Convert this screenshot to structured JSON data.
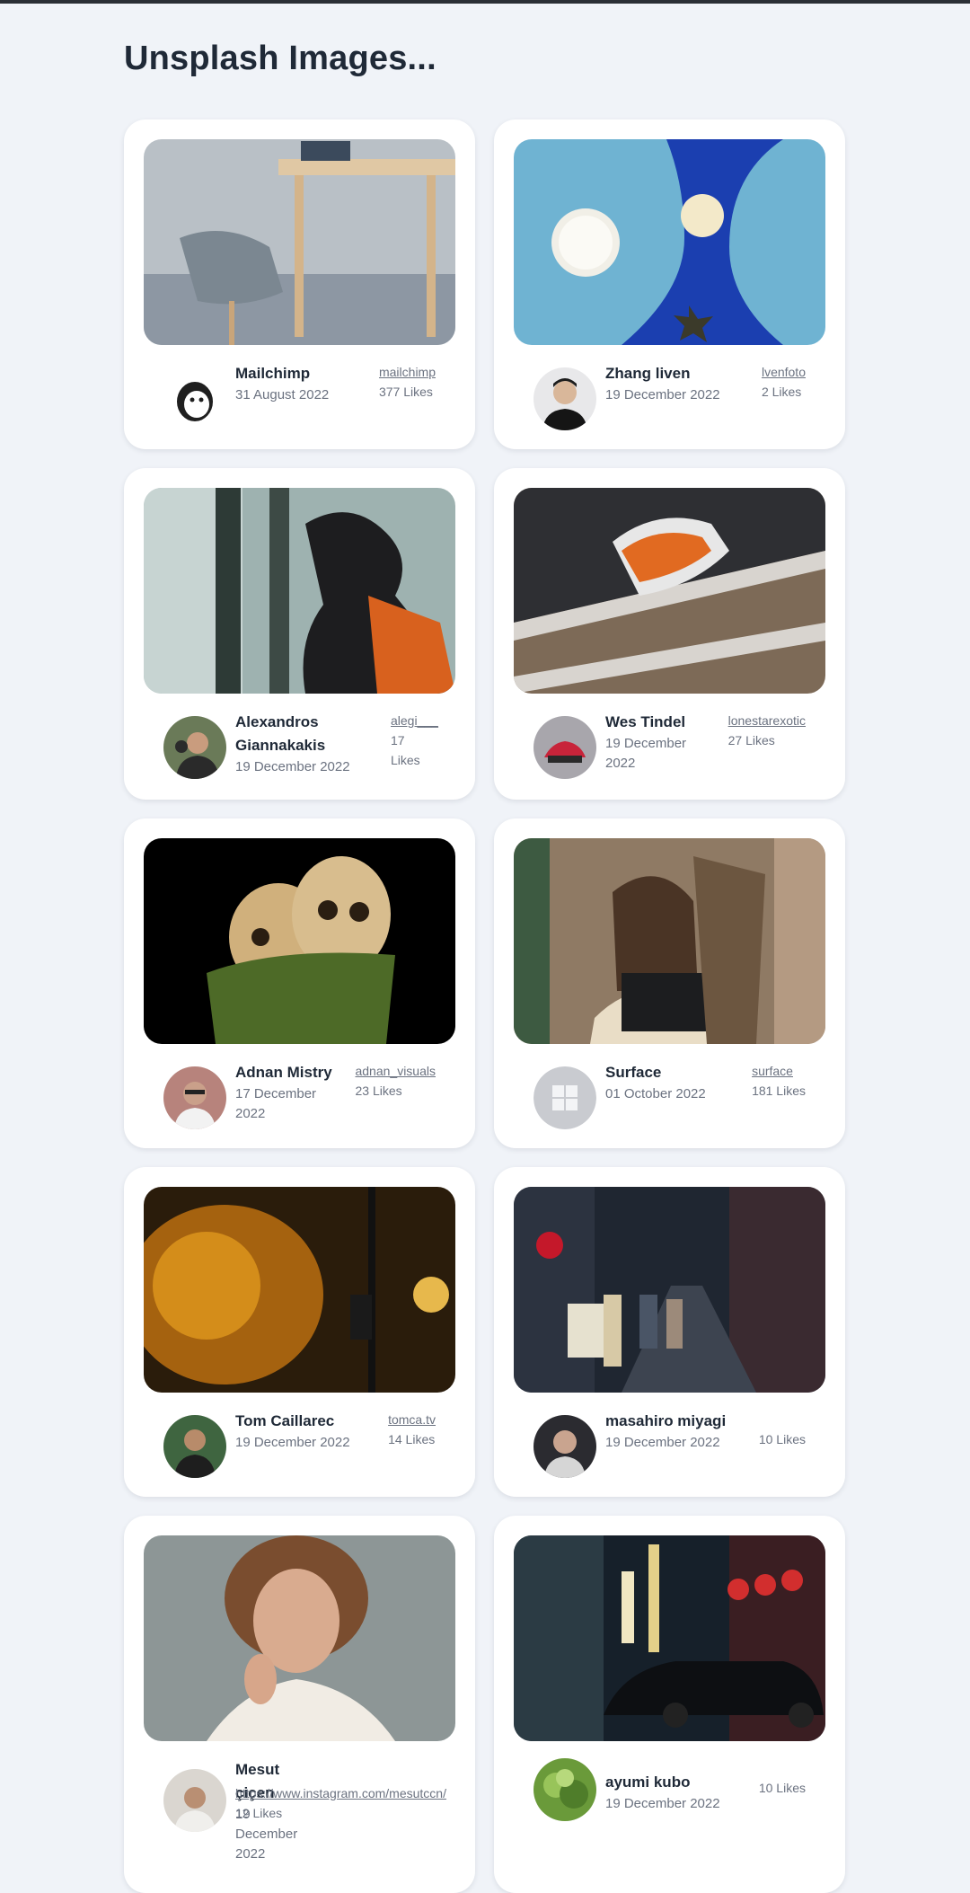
{
  "page": {
    "title": "Unsplash Images..."
  },
  "cards": [
    {
      "name": "Mailchimp",
      "date": "31 August 2022",
      "handle": "mailchimp",
      "likes": "377 Likes",
      "photo_icon": "desk-chair-tablet-photo",
      "avatar_icon": "mailchimp-logo-avatar"
    },
    {
      "name": "Zhang liven",
      "date": "19 December 2022",
      "handle": "lvenfoto",
      "likes": "2 Likes",
      "photo_icon": "blue-moon-candle-photo",
      "avatar_icon": "portrait-avatar"
    },
    {
      "name": "Alexandros Giannakakis",
      "date": "19 December 2022",
      "handle": "alegi___",
      "likes": "17 Likes",
      "photo_icon": "person-window-photo",
      "avatar_icon": "portrait-avatar"
    },
    {
      "name": "Wes Tindel",
      "date": "19 December 2022",
      "handle": "lonestarexotic",
      "likes": "27 Likes",
      "photo_icon": "race-car-photo",
      "avatar_icon": "red-car-avatar"
    },
    {
      "name": "Adnan Mistry",
      "date": "17 December 2022",
      "handle": "adnan_visuals",
      "likes": "23 Likes",
      "photo_icon": "skulls-moss-photo",
      "avatar_icon": "portrait-avatar"
    },
    {
      "name": "Surface",
      "date": "01 October 2022",
      "handle": "surface",
      "likes": "181 Likes",
      "photo_icon": "woman-laptop-photo",
      "avatar_icon": "windows-logo-avatar"
    },
    {
      "name": "Tom Caillarec",
      "date": "19 December 2022",
      "handle": "tomca.tv",
      "likes": "14 Likes",
      "photo_icon": "smoke-streetlight-photo",
      "avatar_icon": "portrait-avatar"
    },
    {
      "name": "masahiro miyagi",
      "date": "19 December 2022",
      "handle": "",
      "likes": "10 Likes",
      "photo_icon": "night-street-photo",
      "avatar_icon": "portrait-avatar"
    },
    {
      "name": "Mesut çiçen",
      "date": "19 December 2022",
      "handle": "https://www.instagram.com/mesutccn/",
      "likes": "12 Likes",
      "photo_icon": "woman-portrait-photo",
      "avatar_icon": "portrait-avatar"
    },
    {
      "name": "ayumi kubo",
      "date": "19 December 2022",
      "handle": "",
      "likes": "10 Likes",
      "photo_icon": "lantern-street-car-photo",
      "avatar_icon": "plant-avatar"
    }
  ]
}
